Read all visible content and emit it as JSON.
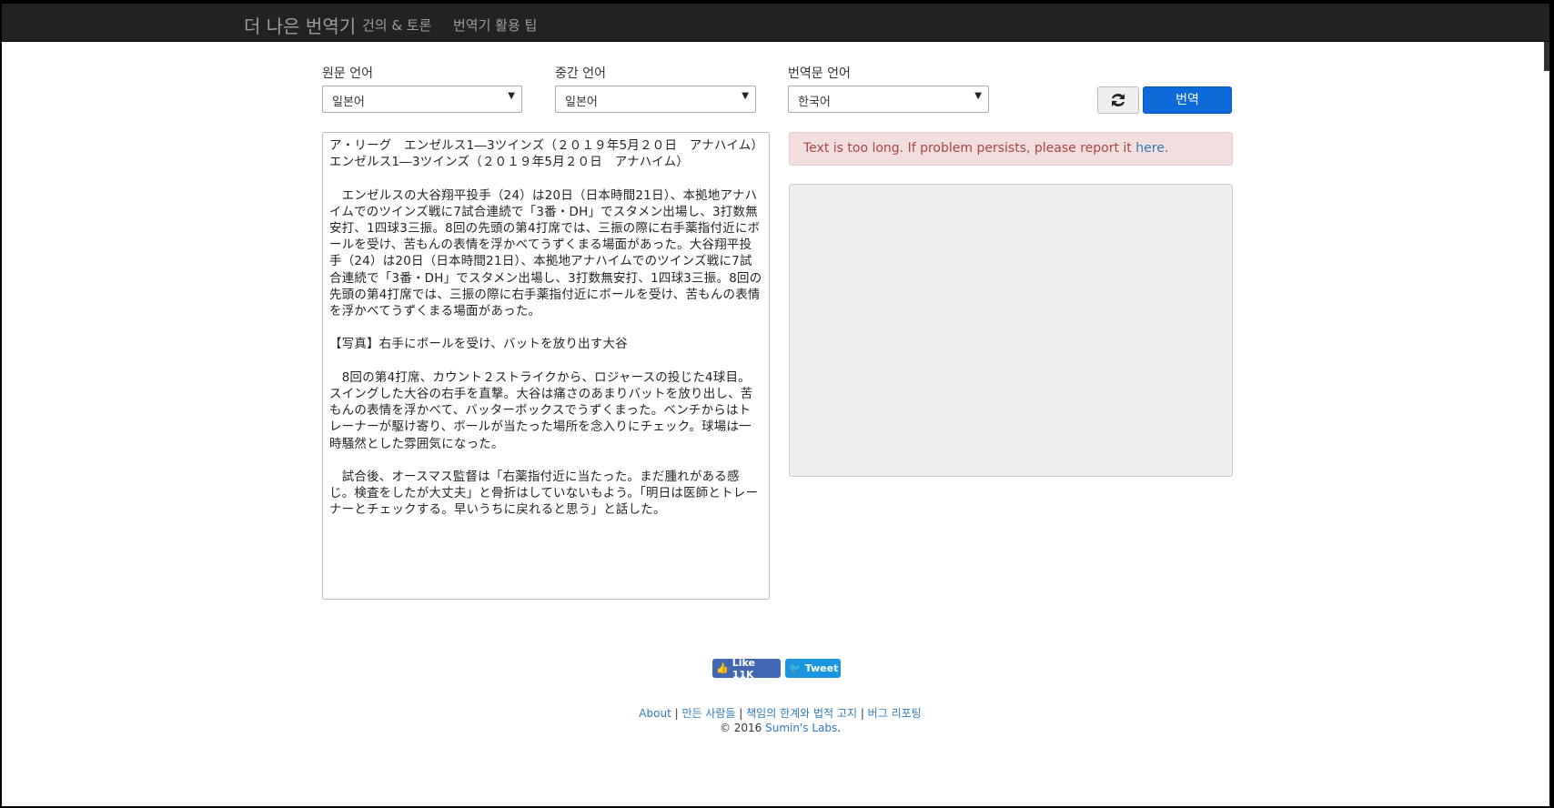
{
  "navbar": {
    "brand": "더 나은 번역기",
    "links": [
      "건의 & 토론",
      "번역기 활용 팁"
    ]
  },
  "controls": {
    "source_label": "원문 언어",
    "source_value": "일본어",
    "middle_label": "중간 언어",
    "middle_value": "일본어",
    "target_label": "번역문 언어",
    "target_value": "한국어",
    "translate_button": "번역"
  },
  "source_text": {
    "p1": "ア・リーグ　エンゼルス1―3ツインズ（２０１９年5月２０日　アナハイム）エンゼルス1―3ツインズ（２０１９年5月２０日　アナハイム）",
    "p2": "　エンゼルスの大谷翔平投手（24）は20日（日本時間21日）、本拠地アナハイムでのツインズ戦に7試合連続で「3番・DH」でスタメン出場し、3打数無安打、1四球3三振。8回の先頭の第4打席では、三振の際に右手薬指付近にボールを受け、苦もんの表情を浮かべてうずくまる場面があった。大谷翔平投手（24）は20日（日本時間21日）、本拠地アナハイムでのツインズ戦に7試合連続で「3番・DH」でスタメン出場し、3打数無安打、1四球3三振。8回の先頭の第4打席では、三振の際に右手薬指付近にボールを受け、苦もんの表情を浮かべてうずくまる場面があった。",
    "p3": "【写真】右手にボールを受け、バットを放り出す大谷",
    "p4": "　8回の第4打席、カウント２ストライクから、ロジャースの投じた4球目。スイングした大谷の右手を直撃。大谷は痛さのあまりバットを放り出し、苦もんの表情を浮かべて、バッターボックスでうずくまった。ベンチからはトレーナーが駆け寄り、ボールが当たった場所を念入りにチェック。球場は一時騒然とした雰囲気になった。",
    "p5": "　試合後、オースマス監督は「右薬指付近に当たった。まだ腫れがある感じ。検査をしたが大丈夫」と骨折はしていないもよう。「明日は医師とトレーナーとチェックする。早いうちに戻れると思う」と話した。"
  },
  "alert": {
    "text": "Text is too long. If problem persists, please report it ",
    "link": "here",
    "suffix": "."
  },
  "social": {
    "like": "Like 11K",
    "tweet": "Tweet"
  },
  "footer": {
    "links": [
      "About",
      "만든 사람들",
      "책임의 한계와 법적 고지",
      "버그 리포팅"
    ],
    "separator": " | ",
    "copyright_prefix": "© 2016 ",
    "copyright_link": "Sumin's Labs",
    "copyright_suffix": "."
  },
  "colors": {
    "navbar_bg": "#222222",
    "primary": "#0d6ad8",
    "alert_bg": "#f2dede",
    "alert_text": "#a94442",
    "link": "#337ab7"
  }
}
